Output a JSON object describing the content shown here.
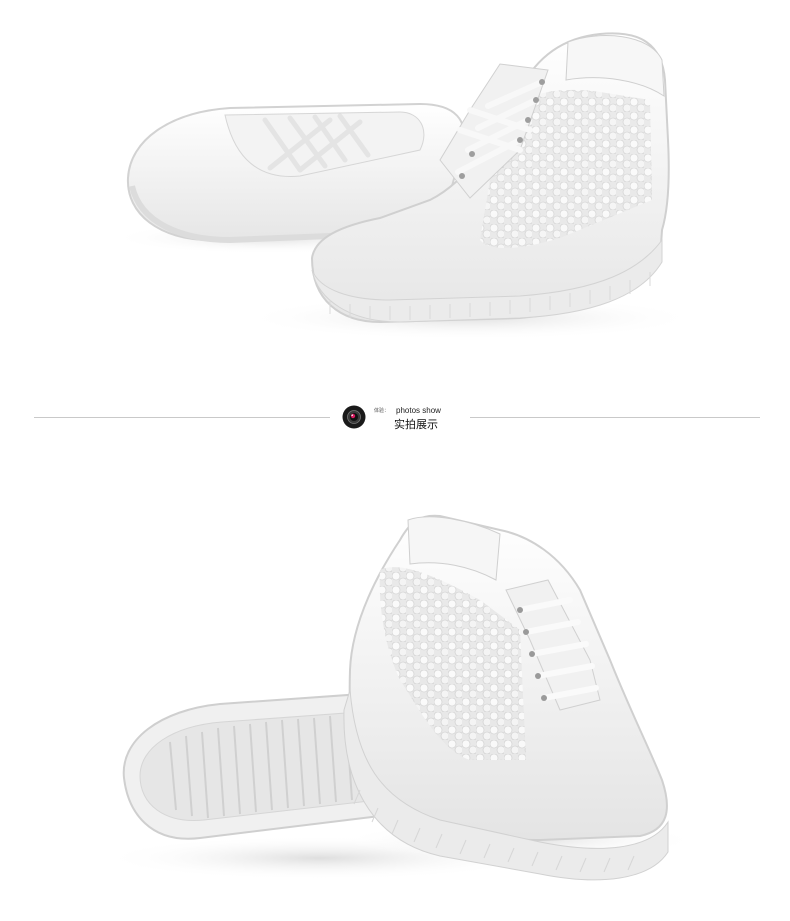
{
  "photos": [
    {
      "name": "product-photo-top",
      "description": "pair of white lace-up wedge sneakers with sequin mesh panel"
    },
    {
      "name": "product-photo-bottom",
      "description": "pair of white wedge sneakers showing side and sole"
    }
  ],
  "divider": {
    "icon": "camera-icon",
    "prefix": "体验：",
    "subtitle": "photos show",
    "title": "实拍展示"
  },
  "colors": {
    "background": "#ffffff",
    "rule": "#c9c9c9",
    "icon_dark": "#1a1a1a",
    "icon_accent": "#d81b60"
  }
}
